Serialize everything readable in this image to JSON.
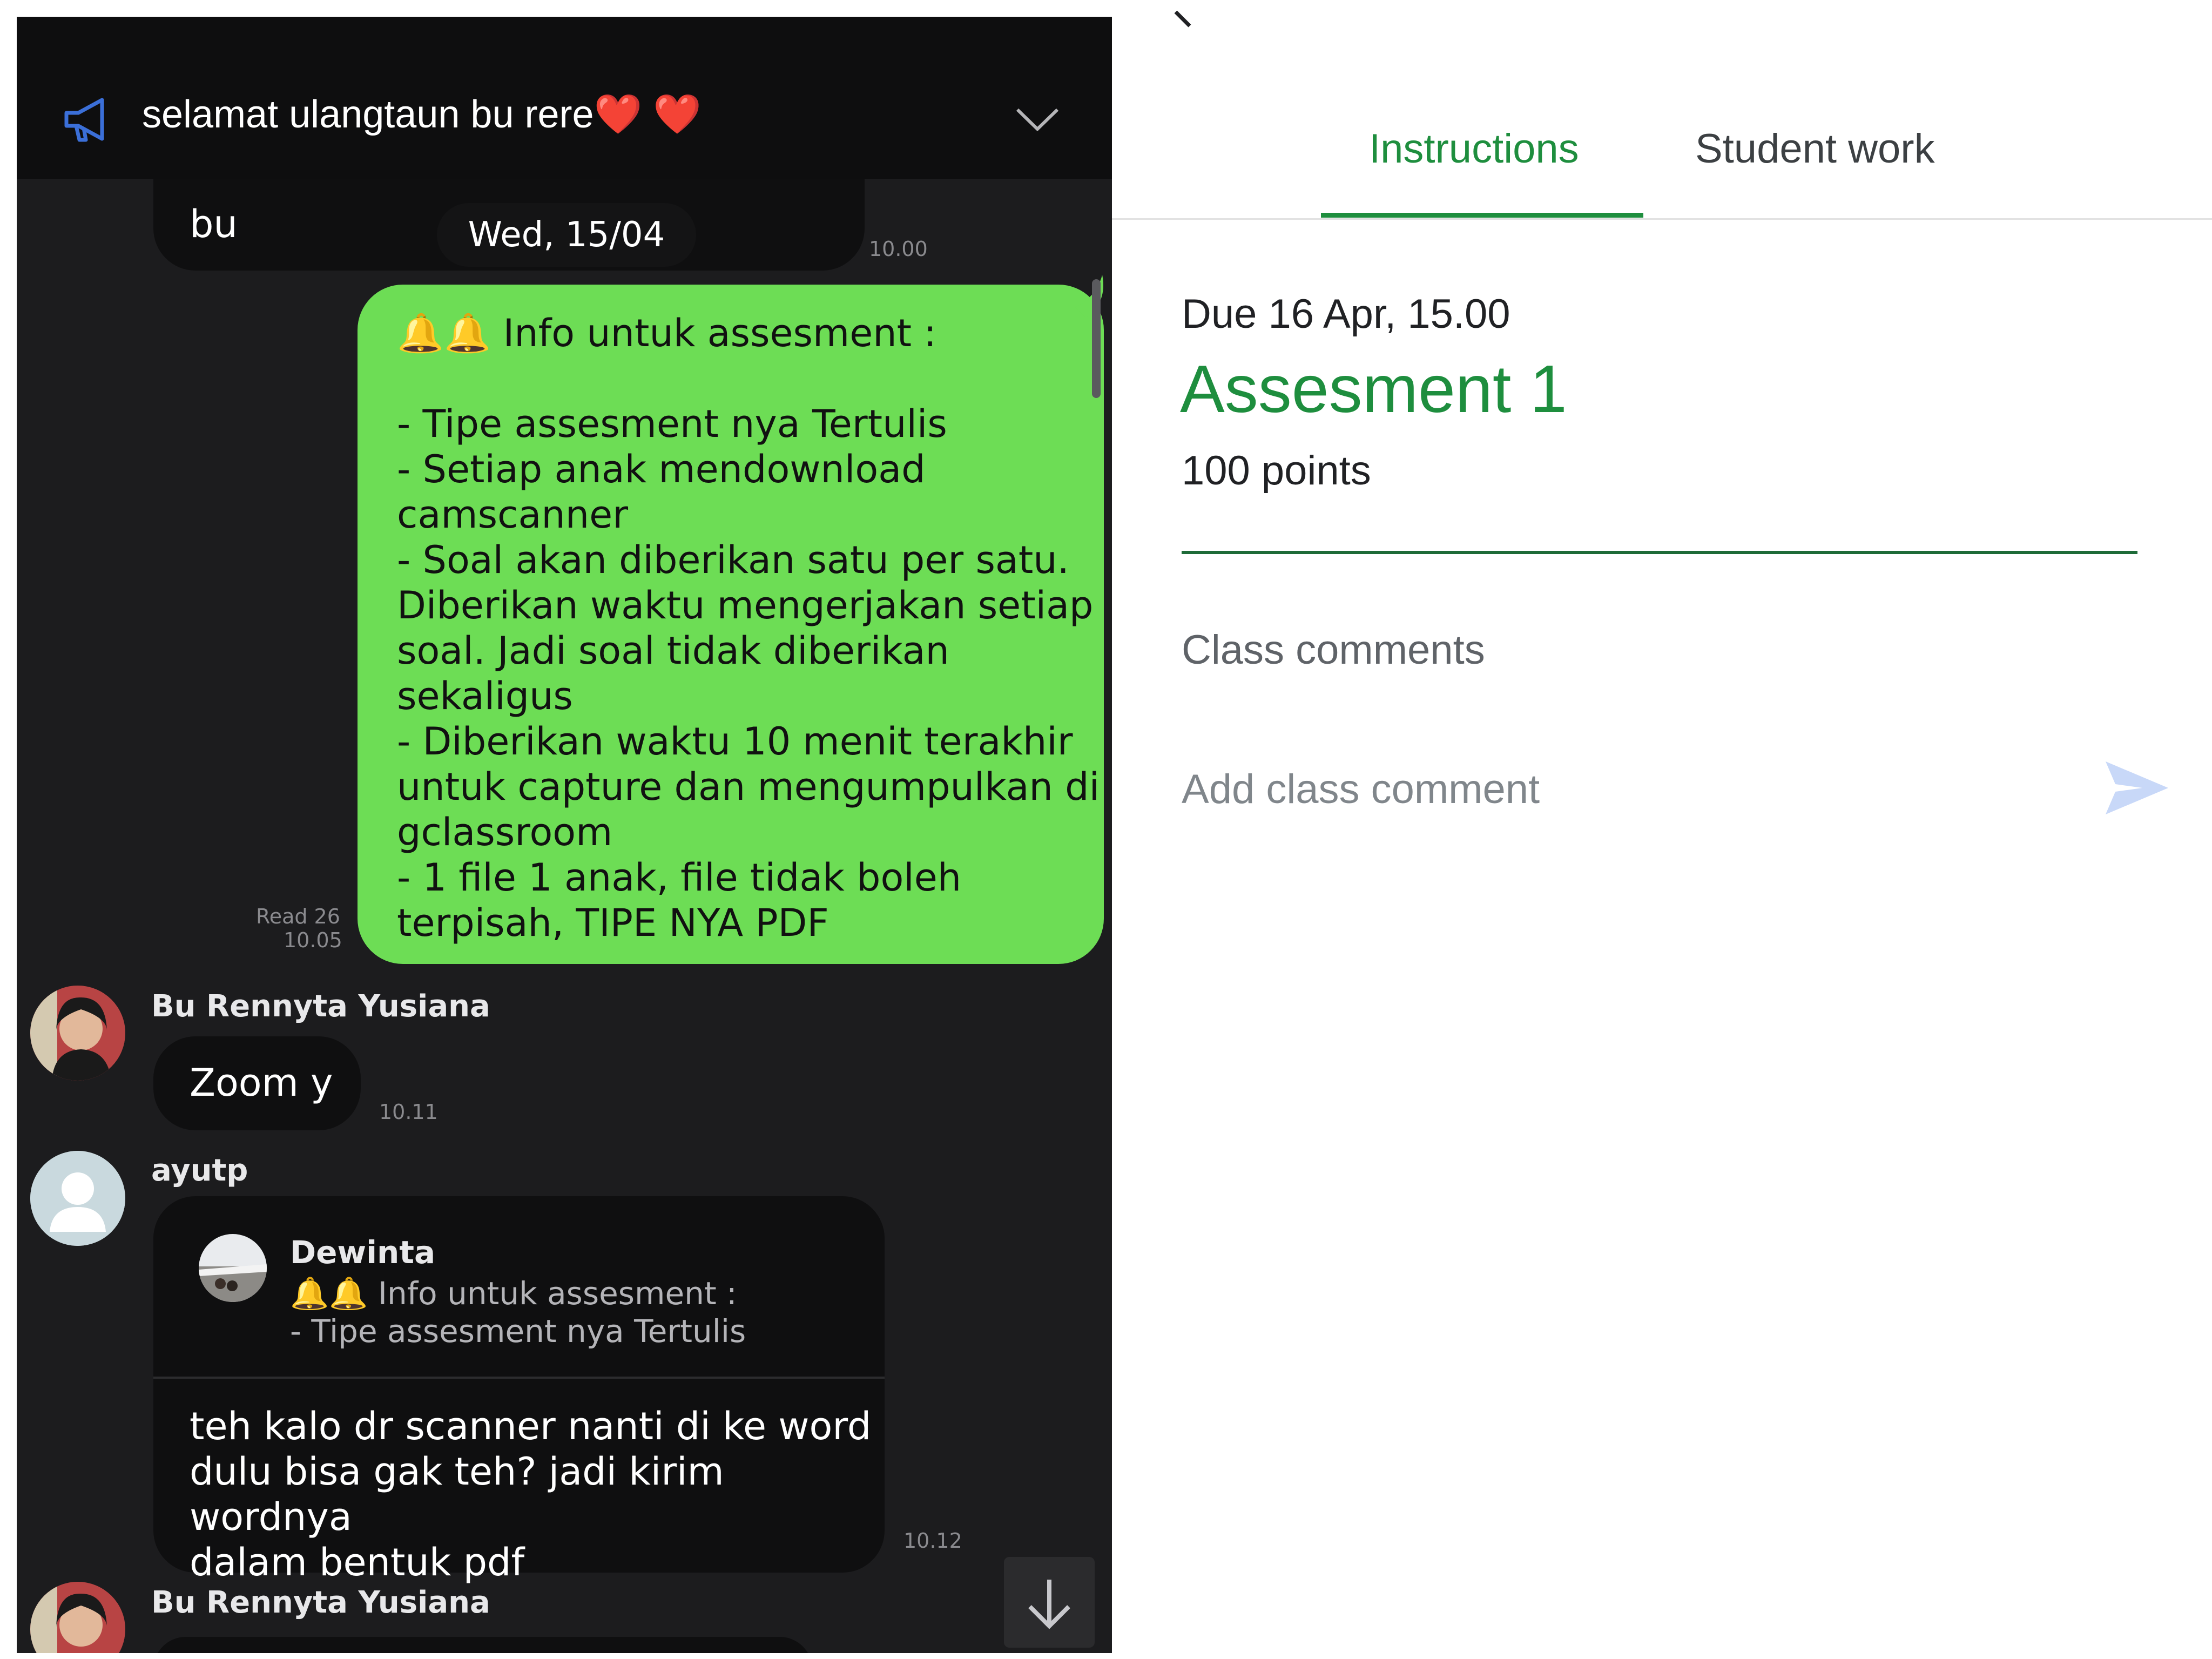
{
  "chat": {
    "announcement": "selamat ulangtaun bu rere❤️ ❤️",
    "partial_message": {
      "text": "bu",
      "time": "10.00"
    },
    "date_pill": "Wed, 15/04",
    "my_message": {
      "text": "🔔🔔 Info untuk assesment :\n\n- Tipe assesment nya Tertulis\n- Setiap anak mendownload\ncamscanner\n- Soal akan diberikan satu per satu.\nDiberikan waktu mengerjakan setiap\nsoal. Jadi soal tidak diberikan\nsekaligus\n- Diberikan waktu 10 menit terakhir\nuntuk capture dan mengumpulkan di\ngclassroom\n- 1 file 1 anak, file tidak boleh\nterpisah, TIPE NYA PDF",
      "read": "Read 26",
      "time": "10.05"
    },
    "msg1": {
      "sender": "Bu Rennyta Yusiana",
      "text": "Zoom y",
      "time": "10.11"
    },
    "msg2": {
      "sender": "ayutp",
      "quote_sender": "Dewinta",
      "quote_line1": "🔔🔔 Info untuk assesment :",
      "quote_line2": "- Tipe assesment nya Tertulis",
      "text": "teh kalo dr scanner nanti di ke word\ndulu bisa gak teh? jadi kirim wordnya\ndalam bentuk pdf",
      "time": "10.12"
    },
    "msg3": {
      "sender": "Bu Rennyta Yusiana"
    },
    "icons": {
      "announcement": "megaphone-icon",
      "expand": "chevron-down-icon",
      "scroll": "arrow-down-icon"
    }
  },
  "classroom": {
    "tabs": [
      {
        "label": "Instructions",
        "active": true
      },
      {
        "label": "Student work",
        "active": false
      }
    ],
    "due": "Due 16 Apr, 15.00",
    "title": "Assesment 1",
    "points": "100 points",
    "comments_label": "Class comments",
    "comment_placeholder": "Add class comment",
    "colors": {
      "accent": "#1e8e3e",
      "send": "#c8d8f8"
    }
  }
}
